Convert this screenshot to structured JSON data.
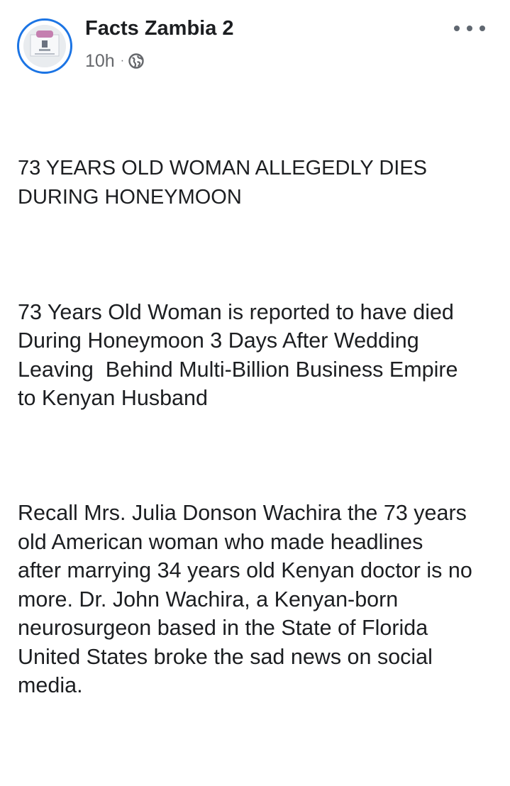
{
  "post": {
    "author": "Facts Zambia 2",
    "timestamp": "10h",
    "separator": "·",
    "audience_icon": "globe-icon",
    "more_icon": "more-options-icon",
    "accent_color": "#1b74e4",
    "paragraphs": [
      "73 YEARS OLD WOMAN ALLEGEDLY DIES\nDURING HONEYMOON",
      "73 Years Old Woman is reported to have died\nDuring Honeymoon 3 Days After Wedding\nLeaving  Behind Multi-Billion Business Empire\nto Kenyan Husband",
      "Recall Mrs. Julia Donson Wachira the 73 years\nold American woman who made headlines\nafter marrying 34 years old Kenyan doctor is no\nmore. Dr. John Wachira, a Kenyan-born\nneurosurgeon based in the State of Florida\nUnited States broke the sad news on social\nmedia."
    ]
  }
}
